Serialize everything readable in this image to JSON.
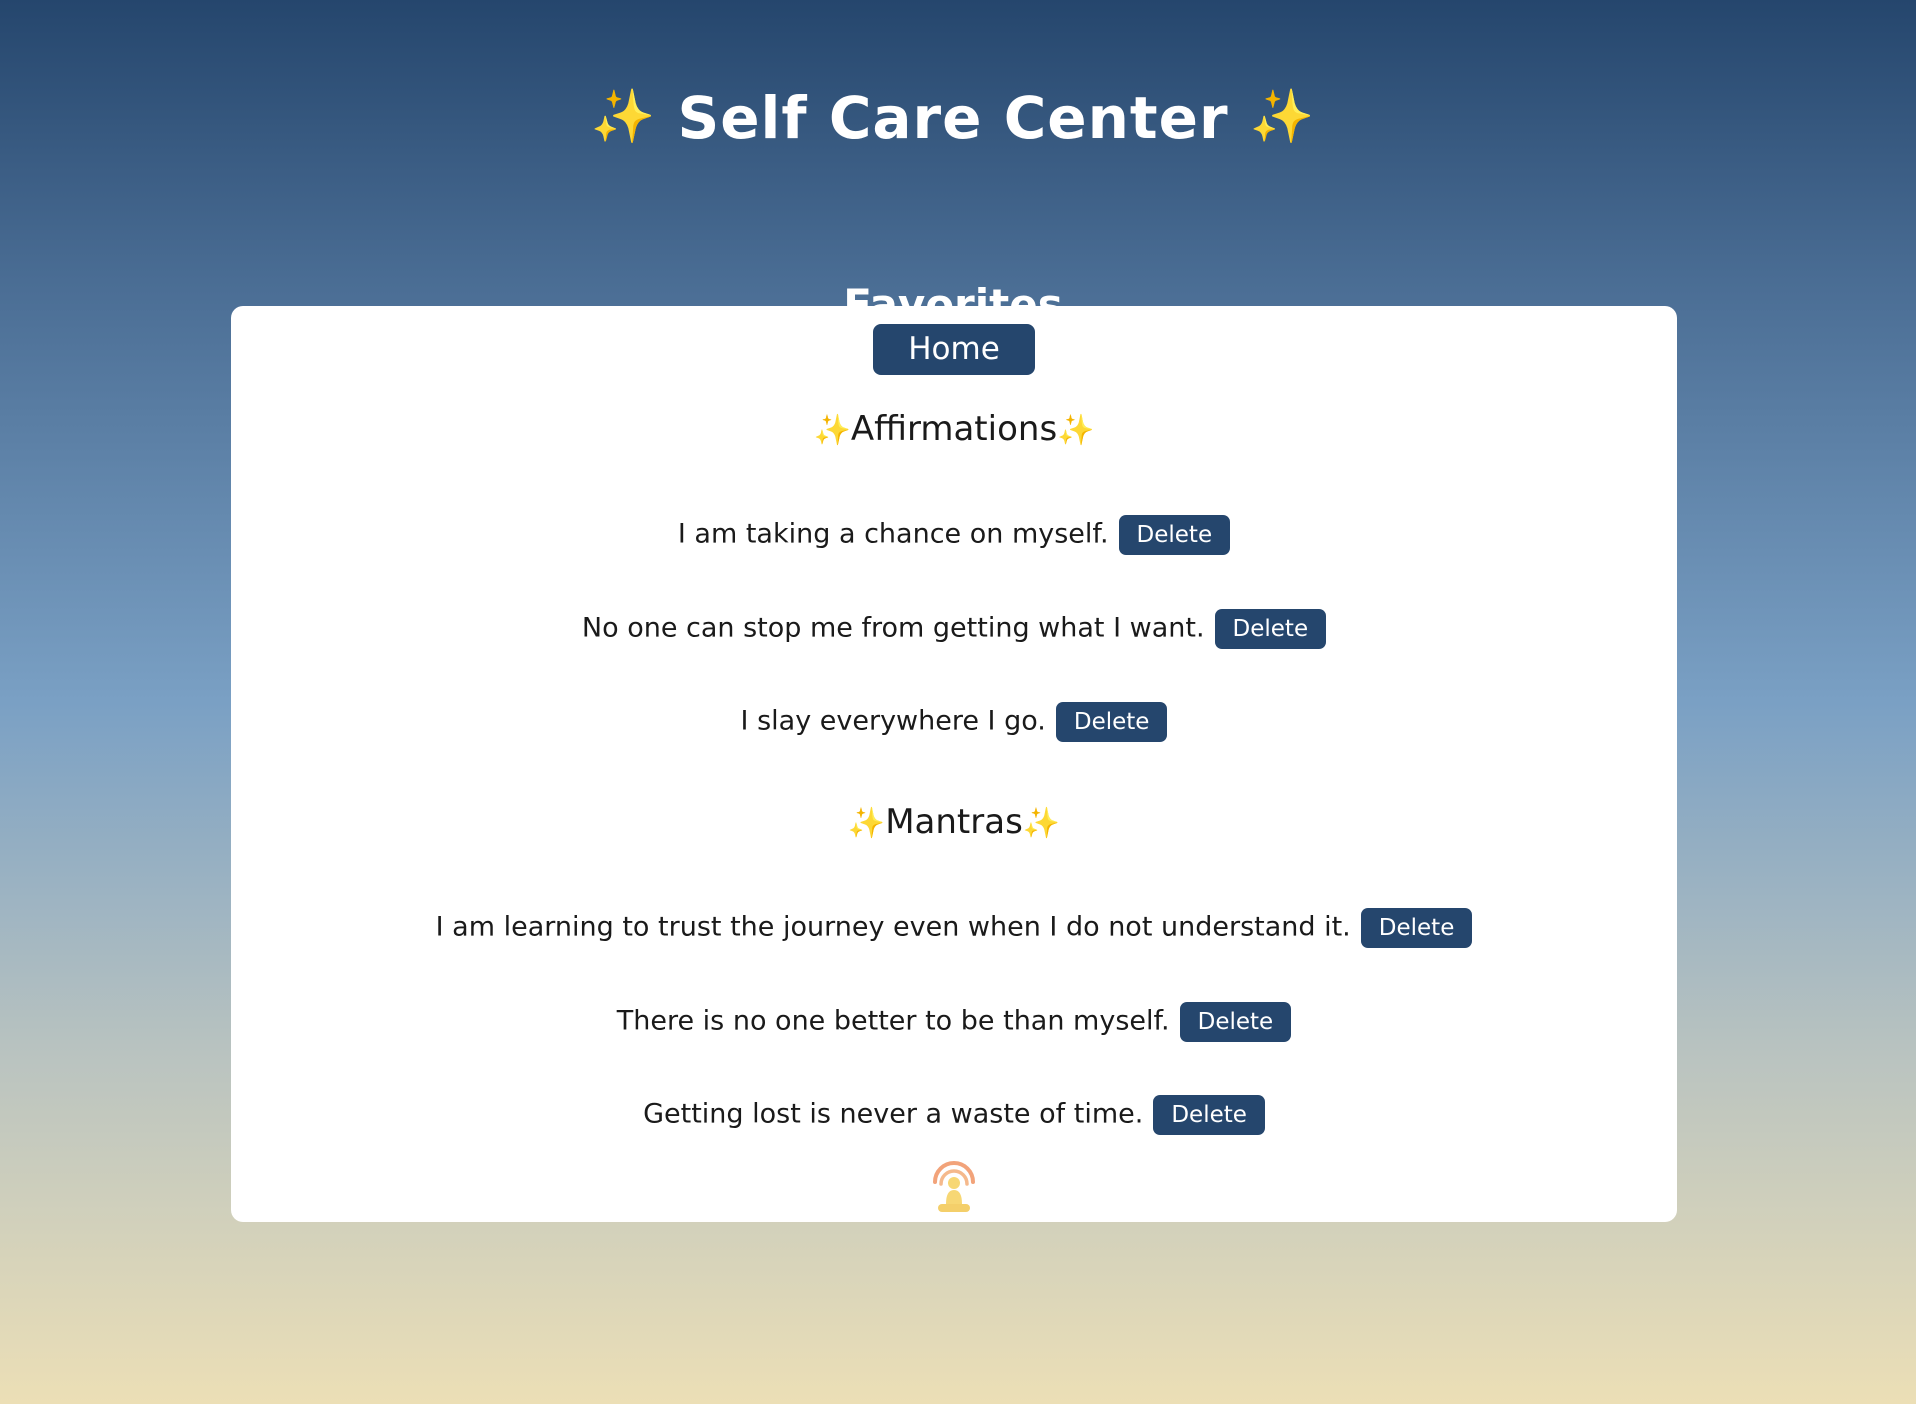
{
  "header": {
    "sparkle_left": "✨",
    "title": "Self Care Center",
    "sparkle_right": "✨"
  },
  "favorites": {
    "heading": "Favorites",
    "home_button_label": "Home",
    "affirmations": {
      "heading_prefix": "✨",
      "heading": "Affirmations",
      "heading_suffix": "✨",
      "items": [
        {
          "text": "I am taking a chance on myself.",
          "delete_label": "Delete"
        },
        {
          "text": "No one can stop me from getting what I want.",
          "delete_label": "Delete"
        },
        {
          "text": "I slay everywhere I go.",
          "delete_label": "Delete"
        }
      ]
    },
    "mantras": {
      "heading_prefix": "✨",
      "heading": "Mantras",
      "heading_suffix": "✨",
      "items": [
        {
          "text": "I am learning to trust the journey even when I do not understand it.",
          "delete_label": "Delete"
        },
        {
          "text": "There is no one better to be than myself.",
          "delete_label": "Delete"
        },
        {
          "text": "Getting lost is never a waste of time.",
          "delete_label": "Delete"
        }
      ]
    },
    "footer_icon": "meditation-bell-icon"
  },
  "colors": {
    "accent": "#25466d",
    "sparkle": "#f6cf3c",
    "gradient_top": "#25466d",
    "gradient_bottom": "#ecdfb6"
  }
}
